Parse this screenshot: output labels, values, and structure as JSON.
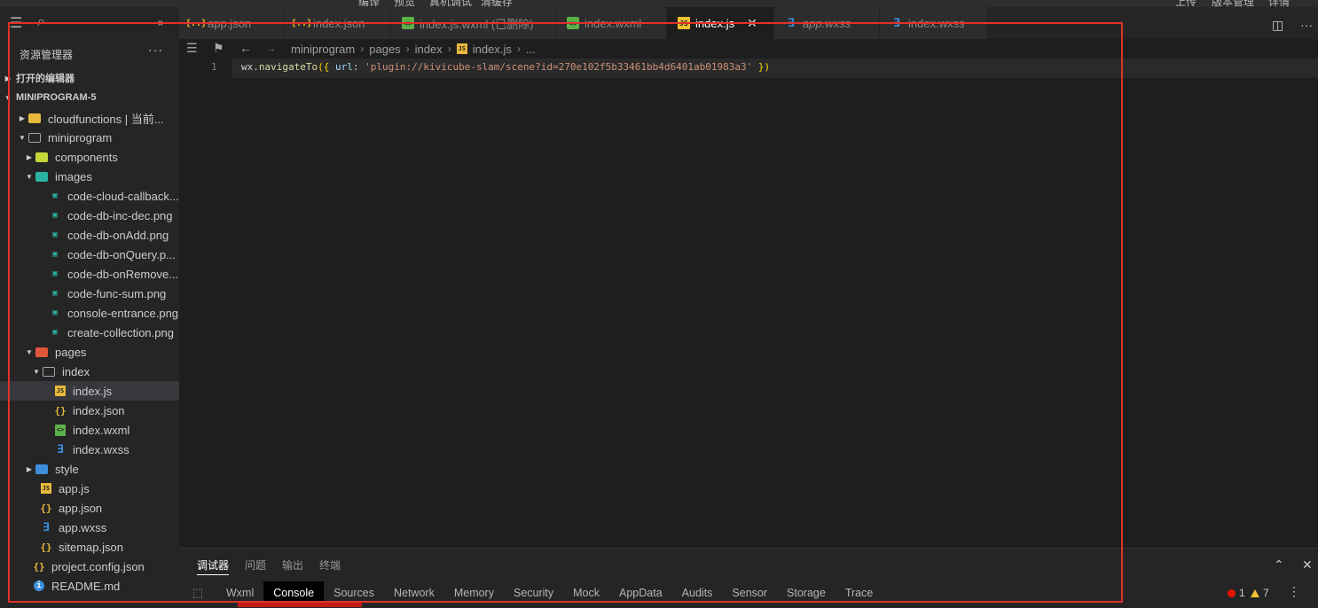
{
  "top_menu": [
    "编译",
    "预览",
    "真机调试",
    "清缓存",
    "上传",
    "版本管理",
    "详情"
  ],
  "tabs": [
    {
      "label": "app.json",
      "icon": "json-icon",
      "active": false
    },
    {
      "label": "index.json",
      "icon": "json-icon",
      "active": false
    },
    {
      "label": "index.js.wxml (已删除)",
      "icon": "wxml-icon",
      "active": false
    },
    {
      "label": "index.wxml",
      "icon": "wxml-icon",
      "active": false
    },
    {
      "label": "index.js",
      "icon": "js-icon",
      "active": true,
      "close": "✕"
    },
    {
      "label": "app.wxss",
      "icon": "wxss-icon",
      "active": false
    },
    {
      "label": "index.wxss",
      "icon": "wxss-icon",
      "active": false
    }
  ],
  "sidebar": {
    "title": "资源管理器",
    "more": "···",
    "open_editors": "打开的编辑器",
    "project": "MINIPROGRAM-5",
    "tree": [
      {
        "label": "cloudfunctions | 当前...",
        "icon": "folder-yellow"
      },
      {
        "label": "miniprogram",
        "icon": "folder-open"
      },
      {
        "label": "components",
        "icon": "folder-lime"
      },
      {
        "label": "images",
        "icon": "folder-teal"
      },
      {
        "label": "code-cloud-callback...",
        "icon": "png"
      },
      {
        "label": "code-db-inc-dec.png",
        "icon": "png"
      },
      {
        "label": "code-db-onAdd.png",
        "icon": "png"
      },
      {
        "label": "code-db-onQuery.p...",
        "icon": "png"
      },
      {
        "label": "code-db-onRemove...",
        "icon": "png"
      },
      {
        "label": "code-func-sum.png",
        "icon": "png"
      },
      {
        "label": "console-entrance.png",
        "icon": "png"
      },
      {
        "label": "create-collection.png",
        "icon": "png"
      },
      {
        "label": "pages",
        "icon": "folder-red"
      },
      {
        "label": "index",
        "icon": "folder-open"
      },
      {
        "label": "index.js",
        "icon": "js"
      },
      {
        "label": "index.json",
        "icon": "json"
      },
      {
        "label": "index.wxml",
        "icon": "wxml"
      },
      {
        "label": "index.wxss",
        "icon": "wxss"
      },
      {
        "label": "style",
        "icon": "folder-blue"
      },
      {
        "label": "app.js",
        "icon": "js"
      },
      {
        "label": "app.json",
        "icon": "json"
      },
      {
        "label": "app.wxss",
        "icon": "wxss"
      },
      {
        "label": "sitemap.json",
        "icon": "json"
      },
      {
        "label": "project.config.json",
        "icon": "json"
      },
      {
        "label": "README.md",
        "icon": "info"
      }
    ]
  },
  "breadcrumb": {
    "items": [
      "miniprogram",
      "pages",
      "index",
      "index.js",
      "..."
    ]
  },
  "editor": {
    "line_number": "1",
    "code_obj": "wx.",
    "code_fn": "navigateTo",
    "code_open": "({",
    "code_key": " url",
    "code_colon": ": ",
    "code_str": "'plugin://kivicube-slam/scene?id=270e102f5b33461bb4d6401ab01983a3'",
    "code_close": " })"
  },
  "panel": {
    "tabs": [
      "调试器",
      "问题",
      "输出",
      "终端"
    ],
    "devtools_tabs": [
      "Wxml",
      "Console",
      "Sources",
      "Network",
      "Memory",
      "Security",
      "Mock",
      "AppData",
      "Audits",
      "Sensor",
      "Storage",
      "Trace"
    ],
    "active_devtab": "Console",
    "error_count": "1",
    "warning_count": "7"
  },
  "colors": {
    "frame": "#e0312b",
    "string": "#ce9178",
    "function": "#dcdcaa"
  }
}
